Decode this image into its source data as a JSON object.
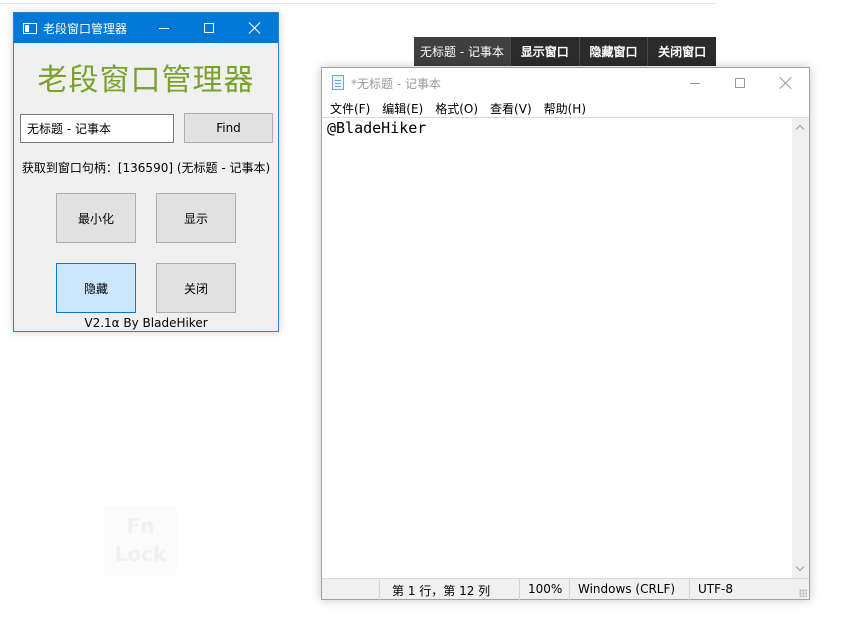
{
  "manager": {
    "window_title": "老段窗口管理器",
    "heading": "老段窗口管理器",
    "search_value": "无标题 - 记事本",
    "find_label": "Find",
    "status_text": "获取到窗口句柄：[136590] (无标题 - 记事本)",
    "buttons": {
      "minimize": "最小化",
      "show": "显示",
      "hide": "隐藏",
      "close": "关闭"
    },
    "footer": "V2.1α By BladeHiker",
    "colors": {
      "titlebar": "#0078d7",
      "heading": "#7aa22a",
      "hide_button": "#cce8ff"
    }
  },
  "floating_toolbar": {
    "target_label": "无标题 - 记事本",
    "show_label": "显示窗口",
    "hide_label": "隐藏窗口",
    "close_label": "关闭窗口"
  },
  "notepad": {
    "window_title": "*无标题 - 记事本",
    "menu": [
      "文件(F)",
      "编辑(E)",
      "格式(O)",
      "查看(V)",
      "帮助(H)"
    ],
    "content": "@BladeHiker",
    "status": {
      "position": "第 1 行，第 12 列",
      "zoom": "100%",
      "line_ending": "Windows (CRLF)",
      "encoding": "UTF-8"
    }
  },
  "watermark": {
    "line1": "Fn",
    "line2": "Lock"
  }
}
